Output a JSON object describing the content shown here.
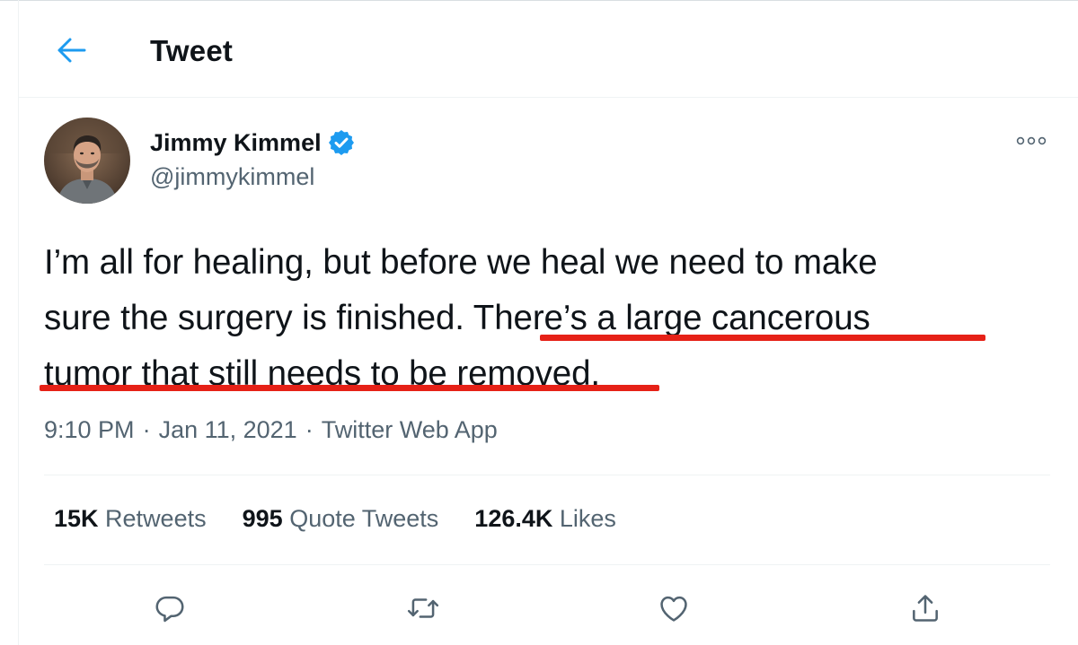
{
  "header": {
    "title": "Tweet",
    "back_icon": "arrow-left-icon"
  },
  "author": {
    "name": "Jimmy Kimmel",
    "handle": "@jimmykimmel",
    "verified": true
  },
  "tweet": {
    "lines": [
      "I’m all for healing, but before we heal we need to make",
      "sure the surgery is finished. There’s a large cancerous",
      "tumor that still needs to be removed."
    ]
  },
  "meta": {
    "time": "9:10 PM",
    "date": "Jan 11, 2021",
    "source": "Twitter Web App",
    "separator": "·"
  },
  "stats": {
    "retweets_count": "15K",
    "retweets_label": "Retweets",
    "quotes_count": "995",
    "quotes_label": "Quote Tweets",
    "likes_count": "126.4K",
    "likes_label": "Likes"
  },
  "colors": {
    "accent": "#1d9bf0",
    "annotation": "#e62117",
    "secondary_text": "#536471"
  },
  "actions": [
    "reply-icon",
    "retweet-icon",
    "like-icon",
    "share-icon"
  ]
}
